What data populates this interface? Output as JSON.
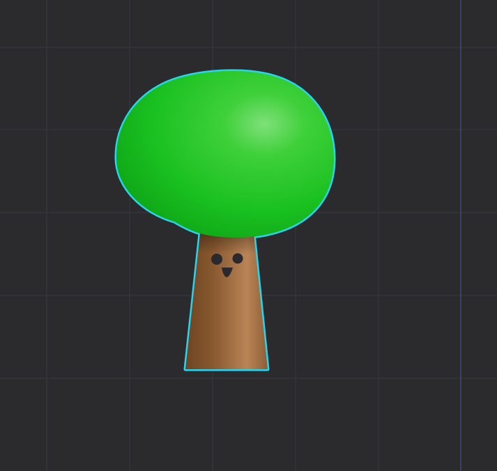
{
  "viewport": {
    "background_color": "#2b2b2d",
    "grid_line_color": "#3a3a3e",
    "axis_line_color": "#4a4a8a"
  },
  "scene_object": {
    "icon": "tree-icon",
    "selected": true,
    "selection_outline_color": "#2ad4ee",
    "canopy_color": "#22c42a",
    "canopy_highlight_color": "#7fe07a",
    "trunk_color": "#8a5a30",
    "trunk_highlight_color": "#b98456",
    "face_color": "#2a2a2e"
  }
}
